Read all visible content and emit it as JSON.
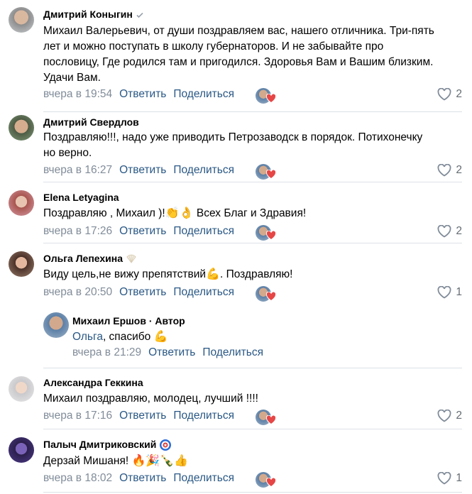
{
  "actions": {
    "reply": "Ответить",
    "share": "Поделиться"
  },
  "colors": {
    "link": "#2a5885",
    "meta": "#818c99",
    "heart": "#e64646"
  },
  "comments": [
    {
      "author": "Дмитрий Коныгин",
      "badge_icon": "verified-check-icon",
      "text_lines": [
        "Михаил Валерьевич, от души поздравляем вас, нашего отличника. Три-пять",
        "лет и можно поступать в школу губернаторов. И не забывайте про",
        "пословицу, Где родился там и пригодился. Здоровья Вам и Вашим близким.",
        "Удачи Вам."
      ],
      "time": "вчера в 19:54",
      "likes": "2"
    },
    {
      "author": "Дмитрий Свердлов",
      "text_lines": [
        "Поздравляю!!!, надо уже приводить Петрозаводск в порядок. Потихонечку",
        "но верно."
      ],
      "time": "вчера в 16:27",
      "likes": "2"
    },
    {
      "author": "Elena Letyagina",
      "text_before": "Поздравляю , Михаил )!",
      "emojis": "👏👌",
      "text_after": " Всех Благ и Здравия!",
      "time": "вчера в 17:26",
      "likes": "2"
    },
    {
      "author": "Ольга Лепехина",
      "badge_icon": "shell-icon",
      "text_before": "Виду цель,не вижу препятствий",
      "emojis": "💪",
      "text_after": ". Поздравляю!",
      "time": "вчера в 20:50",
      "likes": "1"
    },
    {
      "author": "Александра Геккина",
      "text": "Михаил поздравляю, молодец, лучший !!!!",
      "time": "вчера в 17:16",
      "likes": "2"
    },
    {
      "author": "Палыч Дмитриковский",
      "badge_icon": "captain-america-icon",
      "text_before": "Дерзай Мишаня! ",
      "emojis": "🔥🎉🍾👍",
      "time": "вчера в 18:02",
      "likes": "1"
    }
  ],
  "reply": {
    "author": "Михаил Ершов",
    "author_suffix": " · Автор",
    "mention": "Ольга",
    "text": ", спасибо ",
    "emoji": "💪",
    "time": "вчера в 21:29"
  }
}
